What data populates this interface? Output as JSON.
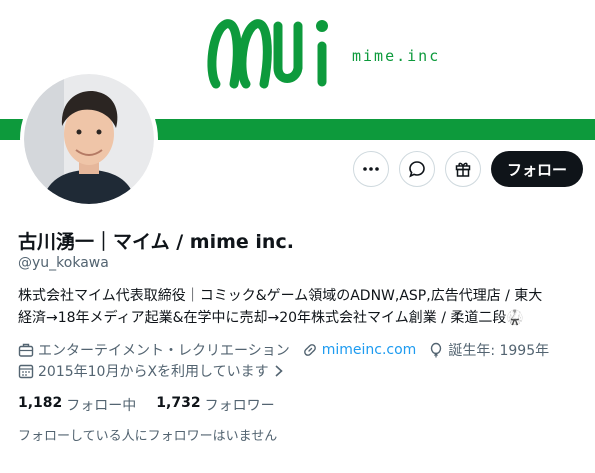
{
  "banner": {
    "brand_text": "mime.inc",
    "accent_color": "#0d9a3c",
    "logo_icon": "mime-logo-icon"
  },
  "profile": {
    "avatar_icon": "avatar",
    "name": "古川湧一｜マイム / mime inc.",
    "handle": "@yu_kokawa",
    "bio_line1": "株式会社マイム代表取締役｜コミック&ゲーム領域のADNW,ASP,広告代理店 / 東大",
    "bio_line2": "経済→18年メディア起業&在学中に売却→20年株式会社マイム創業 / 柔道二段🥋"
  },
  "actions": {
    "more_icon": "more-icon",
    "message_icon": "message-icon",
    "gift_icon": "gift-icon",
    "follow_label": "フォロー"
  },
  "meta": {
    "category": "エンターテイメント・レクリエーション",
    "website": "mimeinc.com",
    "birth": "誕生年: 1995年",
    "joined": "2015年10月からXを利用しています"
  },
  "stats": {
    "following_count": "1,182",
    "following_label": "フォロー中",
    "followers_count": "1,732",
    "followers_label": "フォロワー"
  },
  "mutual_text": "フォローしている人にフォロワーはいません"
}
